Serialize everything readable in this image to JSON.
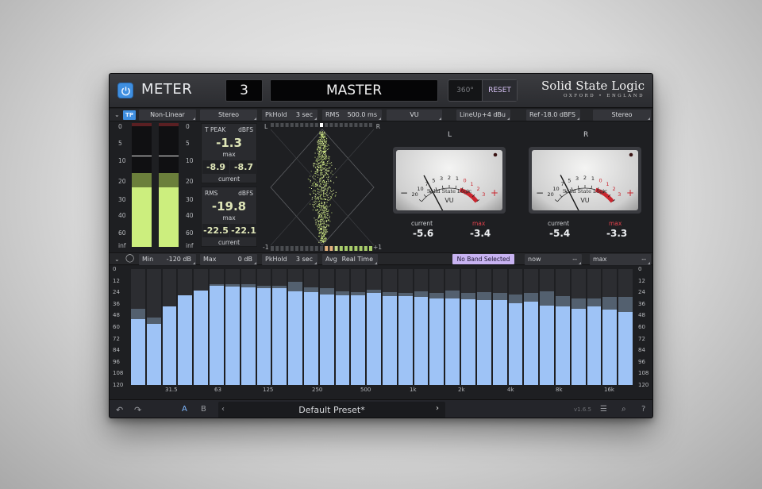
{
  "header": {
    "app_name": "METER",
    "slot_number": "3",
    "bus_name": "MASTER",
    "btn_360": "360°",
    "btn_reset": "RESET",
    "brand_line1": "Solid State Logic",
    "brand_line2": "OXFORD • ENGLAND"
  },
  "top_bar": {
    "tp": "TP",
    "scale_mode": "Non-Linear",
    "channel_mode": "Stereo",
    "pkhold_label": "PkHold",
    "pkhold_value": "3 sec",
    "rms_label": "RMS",
    "rms_value": "500.0 ms",
    "vu_mode": "VU",
    "lineup_label": "LineUp",
    "lineup_value": "+4 dBu",
    "ref_label": "Ref",
    "ref_value": "-18.0 dBFS",
    "vu_channel_mode": "Stereo"
  },
  "level_scale": [
    "0",
    "5",
    "10",
    "20",
    "30",
    "40",
    "60",
    "inf"
  ],
  "level_meters": {
    "left_level": 0.48,
    "right_level": 0.48,
    "left_peak": 0.74,
    "right_peak": 0.74
  },
  "true_peak": {
    "title": "T PEAK",
    "unit": "dBFS",
    "max_value": "-1.3",
    "max_label": "max",
    "current_left": "-8.9",
    "current_right": "-8.7",
    "current_label": "current"
  },
  "rms": {
    "title": "RMS",
    "unit": "dBFS",
    "max_value": "-19.8",
    "max_label": "max",
    "current_left": "-22.5",
    "current_right": "-22.1",
    "current_label": "current"
  },
  "vectorscope": {
    "left_label": "L",
    "right_label": "R",
    "minus_label": "-1",
    "plus_label": "+1"
  },
  "vu_left": {
    "channel": "L",
    "brand": "Solid State Logic",
    "label": "VU",
    "current_label": "current",
    "current": "-5.6",
    "max_label": "max",
    "max": "-3.4",
    "needle_deg": -28
  },
  "vu_right": {
    "channel": "R",
    "brand": "Solid State Logic",
    "label": "VU",
    "current_label": "current",
    "current": "-5.4",
    "max_label": "max",
    "max": "-3.3",
    "needle_deg": -27
  },
  "vu_scale": [
    "20",
    "10",
    "7",
    "5",
    "3",
    "2",
    "1",
    "0",
    "1",
    "2",
    "3"
  ],
  "spectrum_bar": {
    "min_label": "Min",
    "min_value": "-120 dB",
    "max_label": "Max",
    "max_value": "0 dB",
    "pkhold_label": "PkHold",
    "pkhold_value": "3 sec",
    "avg_label": "Avg",
    "avg_value": "Real Time",
    "band_status": "No Band Selected",
    "now_label": "now",
    "now_value": "--",
    "max_readout_label": "max",
    "max_readout_value": "--"
  },
  "chart_data": {
    "type": "bar",
    "ylim": [
      0,
      120
    ],
    "y_ticks": [
      "0",
      "12",
      "24",
      "36",
      "48",
      "60",
      "72",
      "84",
      "96",
      "108",
      "120"
    ],
    "x_tick_labels": [
      "31.5",
      "63",
      "125",
      "250",
      "500",
      "1k",
      "2k",
      "4k",
      "8k",
      "16k"
    ],
    "series": [
      {
        "name": "current",
        "values": [
          68,
          63,
          81,
          93,
          98,
          103,
          102,
          101,
          100,
          100,
          97,
          96,
          94,
          93,
          93,
          95,
          92,
          92,
          91,
          90,
          90,
          89,
          88,
          88,
          85,
          86,
          82,
          81,
          79,
          81,
          78,
          76
        ]
      },
      {
        "name": "peak",
        "values": [
          79,
          70,
          81,
          93,
          98,
          104,
          104,
          104,
          103,
          103,
          107,
          101,
          100,
          97,
          96,
          99,
          96,
          95,
          97,
          95,
          98,
          95,
          96,
          95,
          94,
          95,
          97,
          92,
          90,
          90,
          91,
          91
        ]
      }
    ]
  },
  "footer": {
    "undo_icon": "undo-icon",
    "redo_icon": "redo-icon",
    "a_label": "A",
    "b_label": "B",
    "preset_name": "Default Preset*",
    "version": "v1.6.5"
  },
  "colors": {
    "accent_blue": "#3f8fe0",
    "meter_green": "#ccee7e",
    "spectrum_blue": "#9ec3f6",
    "reset_purple": "#d9c4f7",
    "band_badge": "#c8b3f2",
    "max_red": "#e0424c"
  }
}
